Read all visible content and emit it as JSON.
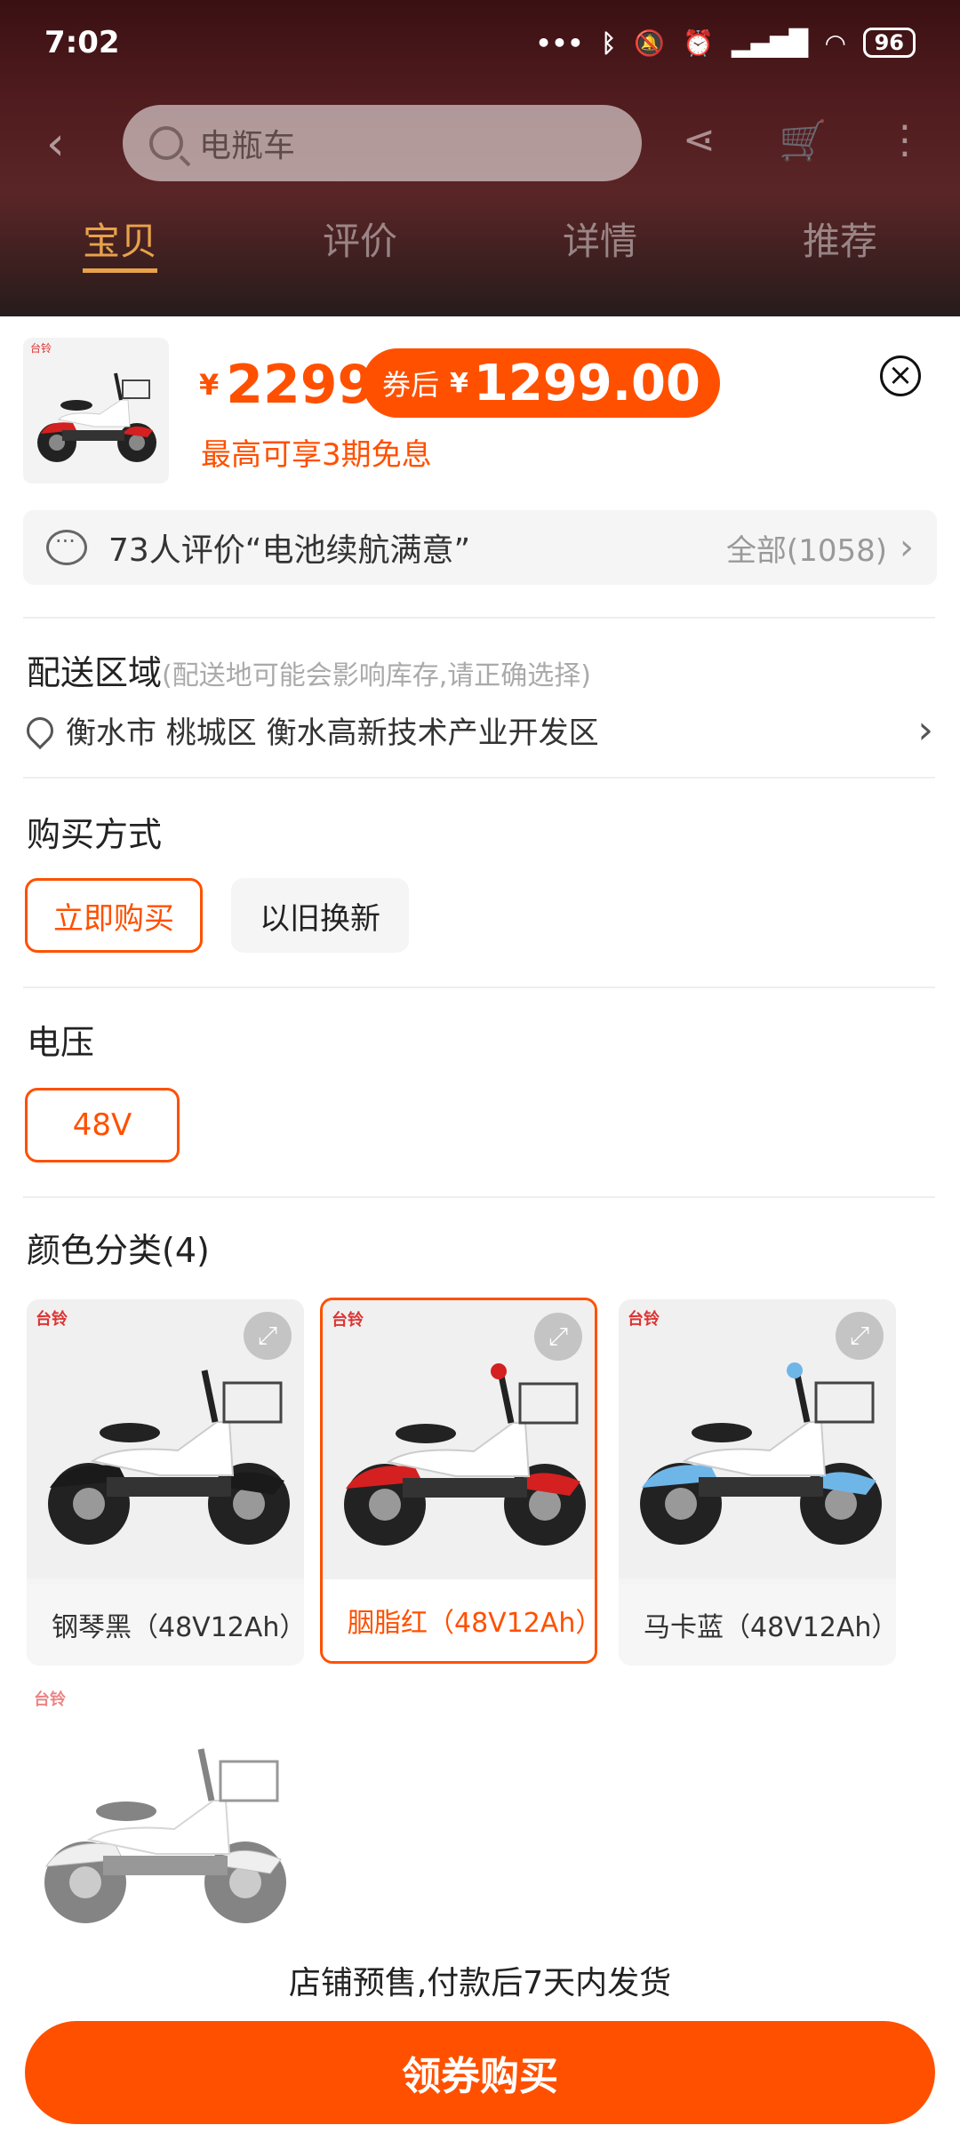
{
  "status_bar": {
    "time": "7:02",
    "battery": "96"
  },
  "topbar": {
    "search_text": "电瓶车"
  },
  "tabs": [
    {
      "label": "宝贝",
      "active": true
    },
    {
      "label": "评价",
      "active": false
    },
    {
      "label": "详情",
      "active": false
    },
    {
      "label": "推荐",
      "active": false
    }
  ],
  "product": {
    "currency": "¥",
    "price": "2299",
    "coupon_label": "券后",
    "coupon_price": "1299.00",
    "promo": "最高可享3期免息"
  },
  "review": {
    "text": "73人评价“电池续航满意”",
    "all": "全部(1058)"
  },
  "delivery": {
    "title": "配送区域",
    "hint": "(配送地可能会影响库存,请正确选择)",
    "address": "衡水市 桃城区 衡水高新技术产业开发区"
  },
  "purchase": {
    "title": "购买方式",
    "options": [
      {
        "label": "立即购买",
        "selected": true
      },
      {
        "label": "以旧换新",
        "selected": false
      }
    ]
  },
  "voltage": {
    "title": "电压",
    "options": [
      {
        "label": "48V",
        "selected": true
      }
    ]
  },
  "colors": {
    "title": "颜色分类(4)",
    "brand": "台铃",
    "items": [
      {
        "label": "钢琴黑（48V12Ah）",
        "selected": false,
        "accent": "#1a1a1a"
      },
      {
        "label": "胭脂红（48V12Ah）",
        "selected": true,
        "accent": "#d42020"
      },
      {
        "label": "马卡蓝（48V12Ah）",
        "selected": false,
        "accent": "#6fb6e8"
      },
      {
        "label": "",
        "selected": false,
        "accent": "#e6e6e6"
      }
    ]
  },
  "footer": {
    "notice": "店铺预售,付款后7天内发货",
    "buy_label": "领券购买"
  },
  "theme": {
    "accent": "#ff5000"
  }
}
